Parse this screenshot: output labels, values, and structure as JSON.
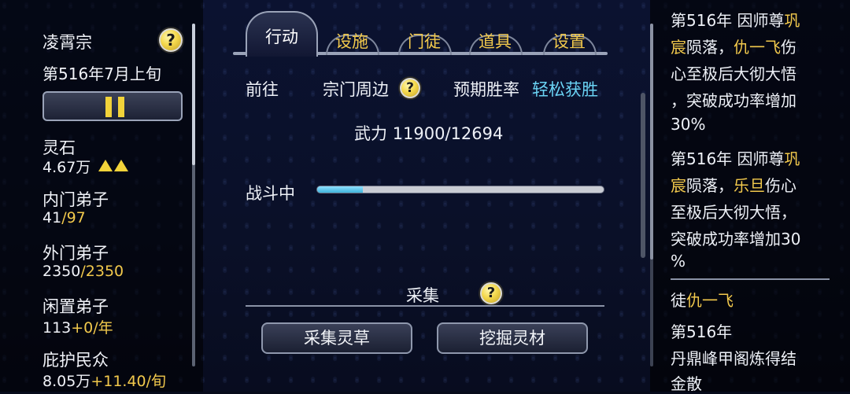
{
  "sidebar": {
    "sect_name": "凌霄宗",
    "date": "第516年7月上旬",
    "stats": [
      {
        "label": "灵石",
        "value": "4.67万",
        "suffix": "",
        "trend": "up-up"
      },
      {
        "label": "内门弟子",
        "value": "41",
        "suffix": "/97"
      },
      {
        "label": "外门弟子",
        "value": "2350",
        "suffix": "/2350"
      },
      {
        "label": "闲置弟子",
        "value": "113",
        "suffix": "+0/年"
      },
      {
        "label": "庇护民众",
        "value": "8.05万",
        "suffix": "+11.40/旬"
      }
    ]
  },
  "tabs": [
    {
      "label": "行动",
      "active": true
    },
    {
      "label": "设施",
      "active": false
    },
    {
      "label": "门徒",
      "active": false
    },
    {
      "label": "道具",
      "active": false
    },
    {
      "label": "设置",
      "active": false
    }
  ],
  "action": {
    "goto_label": "前往",
    "destination": "宗门周边",
    "win_rate_label": "预期胜率",
    "win_rate_value": "轻松获胜",
    "power_label": "武力",
    "power_value": "11900/12694",
    "battle_label": "战斗中",
    "battle_progress": 0.16
  },
  "gather": {
    "title": "采集",
    "herb_button": "采集灵草",
    "mine_button": "挖掘灵材"
  },
  "help_glyph": "?",
  "log": {
    "lines": [
      [
        {
          "t": "第516年 因师尊"
        },
        {
          "t": "巩",
          "c": "gold"
        }
      ],
      [
        {
          "t": "宸",
          "c": "gold"
        },
        {
          "t": "陨落，"
        },
        {
          "t": "仇一飞",
          "c": "gold"
        },
        {
          "t": "伤"
        }
      ],
      [
        {
          "t": "心至极后大彻大悟"
        }
      ],
      [
        {
          "t": "，突破成功率增加"
        }
      ],
      [
        {
          "t": "30%"
        }
      ],
      [
        {
          "t": "第516年 因师尊"
        },
        {
          "t": "巩",
          "c": "gold"
        }
      ],
      [
        {
          "t": "宸",
          "c": "gold"
        },
        {
          "t": "陨落，"
        },
        {
          "t": "乐旦",
          "c": "gold"
        },
        {
          "t": "伤心"
        }
      ],
      [
        {
          "t": "至极后大彻大悟，"
        }
      ],
      [
        {
          "t": "突破成功率增加30"
        }
      ],
      [
        {
          "t": "%"
        }
      ],
      [
        {
          "t": "徒"
        },
        {
          "t": "仇一飞",
          "c": "gold"
        }
      ],
      [
        {
          "t": "第516年"
        }
      ],
      [
        {
          "t": "丹鼎峰甲阁炼得结"
        }
      ],
      [
        {
          "t": "金散"
        }
      ]
    ]
  },
  "colors": {
    "accent_gold": "#f2c94c",
    "accent_cyan": "#6ad3f4",
    "background": "#0a1028"
  }
}
